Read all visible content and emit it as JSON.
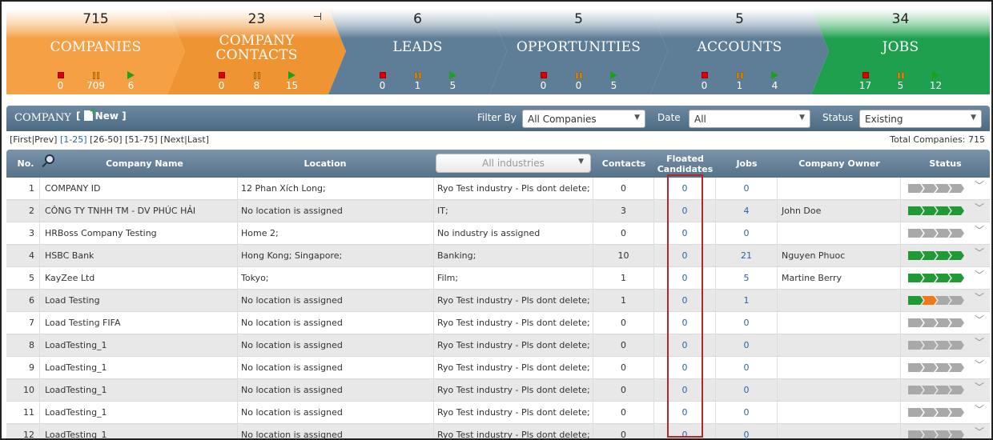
{
  "pipeline": [
    {
      "count": "715",
      "label": "COMPANIES",
      "stats": [
        "0",
        "709",
        "6"
      ],
      "color": "#f5a044"
    },
    {
      "count": "23",
      "label": "COMPANY CONTACTS",
      "stats": [
        "0",
        "8",
        "15"
      ],
      "color": "#ef9432"
    },
    {
      "count": "6",
      "label": "LEADS",
      "stats": [
        "0",
        "1",
        "5"
      ],
      "color": "#5e7d97"
    },
    {
      "count": "5",
      "label": "OPPORTUNITIES",
      "stats": [
        "0",
        "0",
        "5"
      ],
      "color": "#5e7d97"
    },
    {
      "count": "5",
      "label": "ACCOUNTS",
      "stats": [
        "0",
        "1",
        "4"
      ],
      "color": "#5e7d97"
    },
    {
      "count": "34",
      "label": "JOBS",
      "stats": [
        "17",
        "5",
        "12"
      ],
      "color": "#1fa04f"
    }
  ],
  "toolbar": {
    "title": "COMPANY",
    "new_label": "New",
    "filter_label": "Filter By",
    "filter_value": "All Companies",
    "date_label": "Date",
    "date_value": "All",
    "status_label": "Status",
    "status_value": "Existing"
  },
  "paging": {
    "first": "First",
    "prev": "Prev",
    "p1": "1-25",
    "p2": "26-50",
    "p3": "51-75",
    "next": "Next",
    "last": "Last",
    "total": "Total Companies: 715"
  },
  "table": {
    "headers": {
      "no": "No.",
      "name": "Company Name",
      "location": "Location",
      "industry_placeholder": "All industries",
      "contacts": "Contacts",
      "floated": "Floated Candidates",
      "jobs": "Jobs",
      "owner": "Company Owner",
      "status": "Status"
    },
    "rows": [
      {
        "no": "1",
        "name": "COMPANY ID",
        "location": "12 Phan Xích Long;",
        "industry": "Ryo Test industry - Pls dont delete;",
        "contacts": "0",
        "floated": "0",
        "jobs": "0",
        "owner": "",
        "status": "xxxx"
      },
      {
        "no": "2",
        "name": "CÔNG TY TNHH TM - DV PHÚC HẢI",
        "location": "No location is assigned",
        "industry": "IT;",
        "contacts": "3",
        "floated": "0",
        "jobs": "4",
        "owner": "John Doe",
        "status": "gggg"
      },
      {
        "no": "3",
        "name": "HRBoss Company Testing",
        "location": "Home 2;",
        "industry": "No industry is assigned",
        "contacts": "0",
        "floated": "0",
        "jobs": "0",
        "owner": "",
        "status": "xxxx"
      },
      {
        "no": "4",
        "name": "HSBC Bank",
        "location": "Hong Kong; Singapore;",
        "industry": "Banking;",
        "contacts": "10",
        "floated": "0",
        "jobs": "21",
        "owner": "Nguyen Phuoc",
        "status": "gggg"
      },
      {
        "no": "5",
        "name": "KayZee Ltd",
        "location": "Tokyo;",
        "industry": "Film;",
        "contacts": "1",
        "floated": "0",
        "jobs": "5",
        "owner": "Martine Berry",
        "status": "gggg"
      },
      {
        "no": "6",
        "name": "Load Testing",
        "location": "No location is assigned",
        "industry": "Ryo Test industry - Pls dont delete;",
        "contacts": "1",
        "floated": "0",
        "jobs": "1",
        "owner": "",
        "status": "goxx"
      },
      {
        "no": "7",
        "name": "Load Testing FIFA",
        "location": "No location is assigned",
        "industry": "Ryo Test industry - Pls dont delete;",
        "contacts": "0",
        "floated": "0",
        "jobs": "0",
        "owner": "",
        "status": "xxxx"
      },
      {
        "no": "8",
        "name": "LoadTesting_1",
        "location": "No location is assigned",
        "industry": "Ryo Test industry - Pls dont delete;",
        "contacts": "0",
        "floated": "0",
        "jobs": "0",
        "owner": "",
        "status": "xxxx"
      },
      {
        "no": "9",
        "name": "LoadTesting_1",
        "location": "No location is assigned",
        "industry": "Ryo Test industry - Pls dont delete;",
        "contacts": "0",
        "floated": "0",
        "jobs": "0",
        "owner": "",
        "status": "xxxx"
      },
      {
        "no": "10",
        "name": "LoadTesting_1",
        "location": "No location is assigned",
        "industry": "Ryo Test industry - Pls dont delete;",
        "contacts": "0",
        "floated": "0",
        "jobs": "0",
        "owner": "",
        "status": "xxxx"
      },
      {
        "no": "11",
        "name": "LoadTesting_1",
        "location": "No location is assigned",
        "industry": "Ryo Test industry - Pls dont delete;",
        "contacts": "0",
        "floated": "0",
        "jobs": "0",
        "owner": "",
        "status": "xxxx"
      },
      {
        "no": "12",
        "name": "LoadTesting_1",
        "location": "No location is assigned",
        "industry": "Ryo Test industry - Pls dont delete;",
        "contacts": "0",
        "floated": "0",
        "jobs": "0",
        "owner": "",
        "status": "xxxx"
      }
    ]
  },
  "colors": {
    "accent_orange": "#ef9432",
    "accent_green": "#1fa04f",
    "header_blue": "#5e7d97",
    "link_blue": "#2a64a6",
    "highlight_red": "#b3262a"
  }
}
